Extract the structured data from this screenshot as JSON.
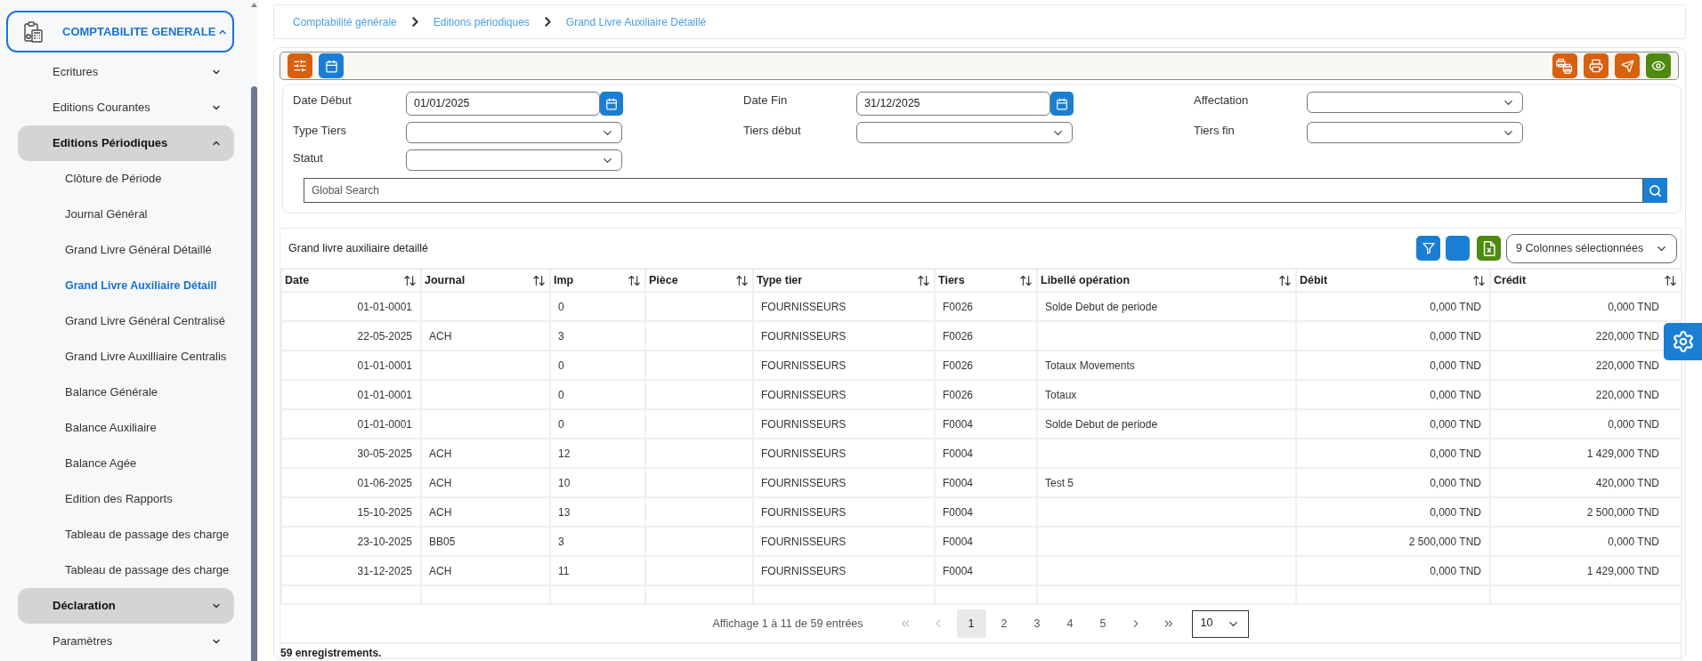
{
  "sidebar": {
    "module": {
      "label": "COMPTABILITE GENERALE",
      "expanded": true
    },
    "items": [
      {
        "label": "Ecritures",
        "expanded": false,
        "selected": false
      },
      {
        "label": "Editions Courantes",
        "expanded": false,
        "selected": false
      },
      {
        "label": "Editions Périodiques",
        "expanded": true,
        "selected": true,
        "children": [
          {
            "label": "Clôture de Période",
            "selected": false
          },
          {
            "label": "Journal Général",
            "selected": false
          },
          {
            "label": "Grand Livre Général Détaillé",
            "selected": false
          },
          {
            "label": "Grand Livre Auxiliaire Détaill",
            "selected": true
          },
          {
            "label": "Grand Livre Général Centralisé",
            "selected": false
          },
          {
            "label": "Grand Livre Auxilliaire Centralis",
            "selected": false
          },
          {
            "label": "Balance Générale",
            "selected": false
          },
          {
            "label": "Balance Auxiliaire",
            "selected": false
          },
          {
            "label": "Balance Agée",
            "selected": false
          },
          {
            "label": "Edition des Rapports",
            "selected": false
          },
          {
            "label": "Tableau de passage des charge",
            "selected": false
          },
          {
            "label": "Tableau de passage des charge",
            "selected": false
          }
        ]
      },
      {
        "label": "Déclaration",
        "expanded": false,
        "selected": true
      },
      {
        "label": "Paramètres",
        "expanded": false,
        "selected": false
      }
    ]
  },
  "breadcrumb": [
    "Comptabilité générale",
    "Editions périodiques",
    "Grand Livre Auxiliaire Détaillé"
  ],
  "filters": {
    "fields": [
      {
        "label": "Date Début",
        "kind": "date",
        "value": "01/01/2025"
      },
      {
        "label": "Date Fin",
        "kind": "date",
        "value": "31/12/2025"
      },
      {
        "label": "Affectation",
        "kind": "select"
      },
      {
        "label": "Type Tiers",
        "kind": "select"
      },
      {
        "label": "Tiers début",
        "kind": "select"
      },
      {
        "label": "Tiers fin",
        "kind": "select"
      },
      {
        "label": "Statut",
        "kind": "select"
      }
    ],
    "search": {
      "placeholder": "Global Search"
    }
  },
  "table": {
    "title": "Grand livre auxiliaire detaillé",
    "column_selector": "9 Colonnes sélectionnées",
    "columns": [
      "Date",
      "Journal",
      "Imp",
      "Pièce",
      "Type tier",
      "Tiers",
      "Libellé opération",
      "Débit",
      "Crédit"
    ],
    "rows": [
      {
        "date": "01-01-0001",
        "imp": "0",
        "type_tier": "FOURNISSEURS",
        "tiers": "F0026",
        "libelle": "Solde Debut de periode",
        "debit": "0,000 TND",
        "credit": "0,000 TND"
      },
      {
        "date": "22-05-2025",
        "journal": "ACH",
        "imp": "3",
        "type_tier": "FOURNISSEURS",
        "tiers": "F0026",
        "debit": "0,000 TND",
        "credit": "220,000 TND"
      },
      {
        "date": "01-01-0001",
        "imp": "0",
        "type_tier": "FOURNISSEURS",
        "tiers": "F0026",
        "libelle": "Totaux Movements",
        "debit": "0,000 TND",
        "credit": "220,000 TND"
      },
      {
        "date": "01-01-0001",
        "imp": "0",
        "type_tier": "FOURNISSEURS",
        "tiers": "F0026",
        "libelle": "Totaux",
        "debit": "0,000 TND",
        "credit": "220,000 TND"
      },
      {
        "date": "01-01-0001",
        "imp": "0",
        "type_tier": "FOURNISSEURS",
        "tiers": "F0004",
        "libelle": "Solde Debut de periode",
        "debit": "0,000 TND",
        "credit": "0,000 TND"
      },
      {
        "date": "30-05-2025",
        "journal": "ACH",
        "imp": "12",
        "type_tier": "FOURNISSEURS",
        "tiers": "F0004",
        "debit": "0,000 TND",
        "credit": "1 429,000 TND"
      },
      {
        "date": "01-06-2025",
        "journal": "ACH",
        "imp": "10",
        "type_tier": "FOURNISSEURS",
        "tiers": "F0004",
        "libelle": "Test 5",
        "debit": "0,000 TND",
        "credit": "420,000 TND"
      },
      {
        "date": "15-10-2025",
        "journal": "ACH",
        "imp": "13",
        "type_tier": "FOURNISSEURS",
        "tiers": "F0004",
        "debit": "0,000 TND",
        "credit": "2 500,000 TND"
      },
      {
        "date": "23-10-2025",
        "journal": "BB05",
        "imp": "3",
        "type_tier": "FOURNISSEURS",
        "tiers": "F0004",
        "debit": "2 500,000 TND",
        "credit": "0,000 TND"
      },
      {
        "date": "31-12-2025",
        "journal": "ACH",
        "imp": "11",
        "type_tier": "FOURNISSEURS",
        "tiers": "F0004",
        "debit": "0,000 TND",
        "credit": "1 429,000 TND"
      }
    ],
    "pagination": {
      "summary": "Affichage 1 à 11 de 59 entrées",
      "first_disabled": true,
      "previous_disabled": true,
      "next_disabled": false,
      "last_disabled": false,
      "pages": [
        {
          "label": "1",
          "selected": true
        },
        {
          "label": "2",
          "selected": false
        },
        {
          "label": "3",
          "selected": false
        },
        {
          "label": "4",
          "selected": false
        },
        {
          "label": "5",
          "selected": false
        }
      ],
      "page_size": "10"
    },
    "record_count": "59 enregistrements."
  }
}
